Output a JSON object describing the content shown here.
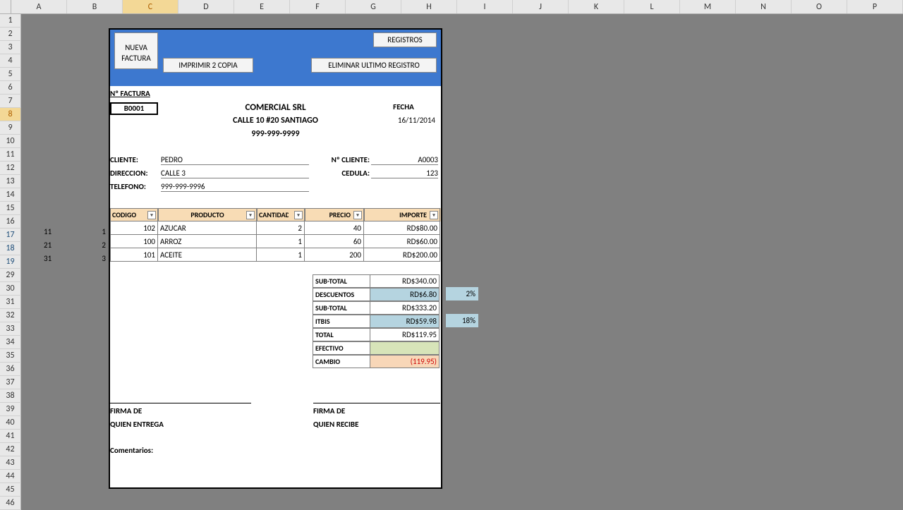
{
  "columns": [
    "A",
    "B",
    "C",
    "D",
    "E",
    "F",
    "G",
    "H",
    "I",
    "J",
    "K",
    "L",
    "M",
    "N",
    "O",
    "P"
  ],
  "selected_col": "C",
  "rows": [
    1,
    2,
    3,
    4,
    5,
    6,
    7,
    8,
    9,
    10,
    11,
    12,
    13,
    14,
    15,
    16,
    17,
    18,
    19,
    29,
    30,
    31,
    32,
    33,
    34,
    35,
    36,
    37,
    38,
    39,
    40,
    41,
    42,
    43,
    44,
    45,
    46
  ],
  "selected_row": 8,
  "blue_rows": [
    17,
    18,
    19
  ],
  "row_annotations": {
    "17": "11",
    "18": "21",
    "19": "31"
  },
  "row_c_nums": {
    "17": "1",
    "18": "2",
    "19": "3"
  },
  "buttons": {
    "nueva": "NUEVA\nFACTURA",
    "registros": "REGISTROS",
    "imprimir": "IMPRIMIR 2 COPIA",
    "eliminar": "ELIMINAR ULTIMO REGISTRO"
  },
  "invoice": {
    "label": "Nº FACTURA",
    "number": "B0001",
    "company": "COMERCIAL SRL",
    "address": "CALLE 10 #20 SANTIAGO",
    "phone": "999-999-9999",
    "fecha_lbl": "FECHA",
    "fecha": "16/11/2014"
  },
  "client": {
    "cliente_lbl": "CLIENTE:",
    "cliente": "PEDRO",
    "direccion_lbl": "DIRECCION:",
    "direccion": "CALLE 3",
    "telefono_lbl": "TELEFONO:",
    "telefono": "999-999-9996",
    "ncliente_lbl": "Nº CLIENTE:",
    "ncliente": "A0003",
    "cedula_lbl": "CEDULA:",
    "cedula": "123"
  },
  "table": {
    "headers": [
      "CODIGO",
      "PRODUCTO",
      "CANTIDAD",
      "PRECIO",
      "IMPORTE"
    ],
    "rows": [
      {
        "codigo": "102",
        "producto": "AZUCAR",
        "cantidad": "2",
        "precio": "40",
        "importe": "RD$80.00"
      },
      {
        "codigo": "100",
        "producto": "ARROZ",
        "cantidad": "1",
        "precio": "60",
        "importe": "RD$60.00"
      },
      {
        "codigo": "101",
        "producto": "ACEITE",
        "cantidad": "1",
        "precio": "200",
        "importe": "RD$200.00"
      }
    ]
  },
  "totals": {
    "subtotal_lbl": "SUB-TOTAL",
    "subtotal": "RD$340.00",
    "desc_lbl": "DESCUENTOS",
    "desc": "RD$6.80",
    "subtotal2_lbl": "SUB-TOTAL",
    "subtotal2": "RD$333.20",
    "itbis_lbl": "ITBIS",
    "itbis": "RD$59.98",
    "total_lbl": "TOTAL",
    "total": "RD$119.95",
    "efectivo_lbl": "EFECTIVO",
    "efectivo": "",
    "cambio_lbl": "CAMBIO",
    "cambio": "(119.95)",
    "pct_desc": "2%",
    "pct_itbis": "18%"
  },
  "signatures": {
    "entrega1": "FIRMA DE",
    "entrega2": "QUIEN ENTREGA",
    "recibe1": "FIRMA DE",
    "recibe2": "QUIEN RECIBE"
  },
  "comentarios_lbl": "Comentarios:"
}
